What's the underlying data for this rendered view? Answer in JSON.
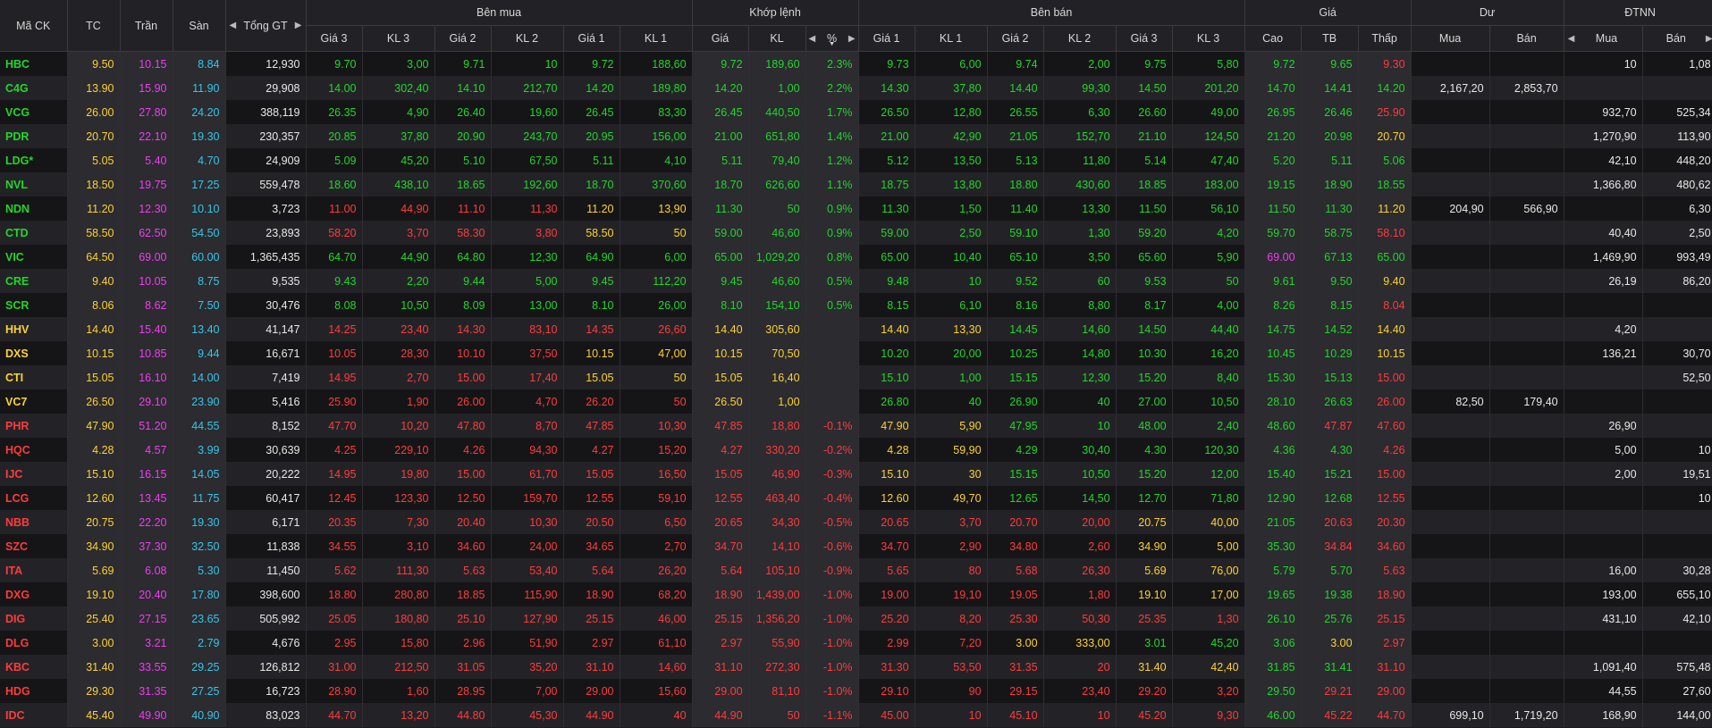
{
  "headers": {
    "symbol": "Mã CK",
    "ref": "TC",
    "ceil": "Trần",
    "floor": "Sàn",
    "total": "Tổng GT",
    "buy_group": "Bên mua",
    "match_group": "Khớp lệnh",
    "sell_group": "Bên bán",
    "price_group": "Giá",
    "rem_group": "Dư",
    "foreign_group": "ĐTNN",
    "buy_cols": [
      "Giá 3",
      "KL 3",
      "Giá 2",
      "KL 2",
      "Giá 1",
      "KL 1"
    ],
    "match_cols": [
      "Giá",
      "KL",
      "%"
    ],
    "sell_cols": [
      "Giá 1",
      "KL 1",
      "Giá 2",
      "KL 2",
      "Giá 3",
      "KL 3"
    ],
    "price_cols": [
      "Cao",
      "TB",
      "Thấp"
    ],
    "rem_cols": [
      "Mua",
      "Bán"
    ],
    "foreign_cols": [
      "Mua",
      "Bán"
    ]
  },
  "icons": {
    "left": "triangle-left-icon",
    "right": "triangle-right-icon",
    "sort": "sort-down-icon"
  },
  "colors": {
    "up": "#22d62a",
    "down": "#ff3b3b",
    "ref": "#ffd230",
    "ceil": "#f23cf0",
    "floor": "#35c6e8"
  },
  "rows": [
    [
      "HBC",
      "9.50",
      "10.15",
      "8.84",
      "12,930",
      "9.70",
      "3,00",
      "9.71",
      "10",
      "9.72",
      "188,60",
      "9.72",
      "189,60",
      "2.3%",
      "9.73",
      "6,00",
      "9.74",
      "2,00",
      "9.75",
      "5,80",
      "9.72",
      "9.65",
      "9.30",
      "",
      "",
      "10",
      "1,08"
    ],
    [
      "C4G",
      "13.90",
      "15.90",
      "11.90",
      "29,908",
      "14.00",
      "302,40",
      "14.10",
      "212,70",
      "14.20",
      "189,80",
      "14.20",
      "1,00",
      "2.2%",
      "14.30",
      "37,80",
      "14.40",
      "99,30",
      "14.50",
      "201,20",
      "14.70",
      "14.41",
      "14.20",
      "2,167,20",
      "2,853,70",
      "",
      ""
    ],
    [
      "VCG",
      "26.00",
      "27.80",
      "24.20",
      "388,119",
      "26.35",
      "4,90",
      "26.40",
      "19,60",
      "26.45",
      "83,30",
      "26.45",
      "440,50",
      "1.7%",
      "26.50",
      "12,80",
      "26.55",
      "6,30",
      "26.60",
      "49,00",
      "26.95",
      "26.46",
      "25.90",
      "",
      "",
      "932,70",
      "525,34"
    ],
    [
      "PDR",
      "20.70",
      "22.10",
      "19.30",
      "230,357",
      "20.85",
      "37,80",
      "20.90",
      "243,70",
      "20.95",
      "156,00",
      "21.00",
      "651,80",
      "1.4%",
      "21.00",
      "42,90",
      "21.05",
      "152,70",
      "21.10",
      "124,50",
      "21.20",
      "20.98",
      "20.70",
      "",
      "",
      "1,270,90",
      "113,90"
    ],
    [
      "LDG*",
      "5.05",
      "5.40",
      "4.70",
      "24,909",
      "5.09",
      "45,20",
      "5.10",
      "67,50",
      "5.11",
      "4,10",
      "5.11",
      "79,40",
      "1.2%",
      "5.12",
      "13,50",
      "5.13",
      "11,80",
      "5.14",
      "47,40",
      "5.20",
      "5.11",
      "5.06",
      "",
      "",
      "42,10",
      "448,20"
    ],
    [
      "NVL",
      "18.50",
      "19.75",
      "17.25",
      "559,478",
      "18.60",
      "438,10",
      "18.65",
      "192,60",
      "18.70",
      "370,60",
      "18.70",
      "626,60",
      "1.1%",
      "18.75",
      "13,80",
      "18.80",
      "430,60",
      "18.85",
      "183,00",
      "19.15",
      "18.90",
      "18.55",
      "",
      "",
      "1,366,80",
      "480,62"
    ],
    [
      "NDN",
      "11.20",
      "12.30",
      "10.10",
      "3,723",
      "11.00",
      "44,90",
      "11.10",
      "11,30",
      "11.20",
      "13,90",
      "11.30",
      "50",
      "0.9%",
      "11.30",
      "1,50",
      "11.40",
      "13,30",
      "11.50",
      "56,10",
      "11.50",
      "11.30",
      "11.20",
      "204,90",
      "566,90",
      "",
      "6,30"
    ],
    [
      "CTD",
      "58.50",
      "62.50",
      "54.50",
      "23,893",
      "58.20",
      "3,70",
      "58.30",
      "3,80",
      "58.50",
      "50",
      "59.00",
      "46,60",
      "0.9%",
      "59.00",
      "2,50",
      "59.10",
      "1,30",
      "59.20",
      "4,20",
      "59.70",
      "58.75",
      "58.10",
      "",
      "",
      "40,40",
      "2,50"
    ],
    [
      "VIC",
      "64.50",
      "69.00",
      "60.00",
      "1,365,435",
      "64.70",
      "44,90",
      "64.80",
      "12,30",
      "64.90",
      "6,00",
      "65.00",
      "1,029,20",
      "0.8%",
      "65.00",
      "10,40",
      "65.10",
      "3,50",
      "65.60",
      "5,90",
      "69.00",
      "67.13",
      "65.00",
      "",
      "",
      "1,469,90",
      "993,49"
    ],
    [
      "CRE",
      "9.40",
      "10.05",
      "8.75",
      "9,535",
      "9.43",
      "2,20",
      "9.44",
      "5,00",
      "9.45",
      "112,20",
      "9.45",
      "46,60",
      "0.5%",
      "9.48",
      "10",
      "9.52",
      "60",
      "9.53",
      "50",
      "9.61",
      "9.50",
      "9.40",
      "",
      "",
      "26,19",
      "86,20"
    ],
    [
      "SCR",
      "8.06",
      "8.62",
      "7.50",
      "30,476",
      "8.08",
      "10,50",
      "8.09",
      "13,00",
      "8.10",
      "26,00",
      "8.10",
      "154,10",
      "0.5%",
      "8.15",
      "6,10",
      "8.16",
      "8,80",
      "8.17",
      "4,00",
      "8.26",
      "8.15",
      "8.04",
      "",
      "",
      "",
      ""
    ],
    [
      "HHV",
      "14.40",
      "15.40",
      "13.40",
      "41,147",
      "14.25",
      "23,40",
      "14.30",
      "83,10",
      "14.35",
      "26,60",
      "14.40",
      "305,60",
      "",
      "14.40",
      "13,30",
      "14.45",
      "14,60",
      "14.50",
      "44,40",
      "14.75",
      "14.52",
      "14.40",
      "",
      "",
      "4,20",
      ""
    ],
    [
      "DXS",
      "10.15",
      "10.85",
      "9.44",
      "16,671",
      "10.05",
      "28,30",
      "10.10",
      "37,50",
      "10.15",
      "47,00",
      "10.15",
      "70,50",
      "",
      "10.20",
      "20,00",
      "10.25",
      "14,80",
      "10.30",
      "16,20",
      "10.45",
      "10.29",
      "10.15",
      "",
      "",
      "136,21",
      "30,70"
    ],
    [
      "CTI",
      "15.05",
      "16.10",
      "14.00",
      "7,419",
      "14.95",
      "2,70",
      "15.00",
      "17,40",
      "15.05",
      "50",
      "15.05",
      "16,40",
      "",
      "15.10",
      "1,00",
      "15.15",
      "12,30",
      "15.20",
      "8,40",
      "15.30",
      "15.13",
      "15.00",
      "",
      "",
      "",
      "52,50"
    ],
    [
      "VC7",
      "26.50",
      "29.10",
      "23.90",
      "5,416",
      "25.90",
      "1,90",
      "26.00",
      "4,70",
      "26.20",
      "50",
      "26.50",
      "1,00",
      "",
      "26.80",
      "40",
      "26.90",
      "40",
      "27.00",
      "10,50",
      "28.10",
      "26.63",
      "26.00",
      "82,50",
      "179,40",
      "",
      ""
    ],
    [
      "PHR",
      "47.90",
      "51.20",
      "44.55",
      "8,152",
      "47.70",
      "10,20",
      "47.80",
      "8,70",
      "47.85",
      "10,30",
      "47.85",
      "18,80",
      "-0.1%",
      "47.90",
      "5,90",
      "47.95",
      "10",
      "48.00",
      "2,40",
      "48.60",
      "47.87",
      "47.60",
      "",
      "",
      "26,90",
      ""
    ],
    [
      "HQC",
      "4.28",
      "4.57",
      "3.99",
      "30,639",
      "4.25",
      "229,10",
      "4.26",
      "94,30",
      "4.27",
      "15,20",
      "4.27",
      "330,20",
      "-0.2%",
      "4.28",
      "59,90",
      "4.29",
      "30,40",
      "4.30",
      "120,30",
      "4.36",
      "4.30",
      "4.26",
      "",
      "",
      "5,00",
      "10"
    ],
    [
      "IJC",
      "15.10",
      "16.15",
      "14.05",
      "20,222",
      "14.95",
      "19,80",
      "15.00",
      "61,70",
      "15.05",
      "16,50",
      "15.05",
      "46,90",
      "-0.3%",
      "15.10",
      "30",
      "15.15",
      "10,50",
      "15.20",
      "12,00",
      "15.40",
      "15.21",
      "15.00",
      "",
      "",
      "2,00",
      "19,51"
    ],
    [
      "LCG",
      "12.60",
      "13.45",
      "11.75",
      "60,417",
      "12.45",
      "123,30",
      "12.50",
      "159,70",
      "12.55",
      "59,10",
      "12.55",
      "463,40",
      "-0.4%",
      "12.60",
      "49,70",
      "12.65",
      "14,50",
      "12.70",
      "71,80",
      "12.90",
      "12.68",
      "12.55",
      "",
      "",
      "",
      "10"
    ],
    [
      "NBB",
      "20.75",
      "22.20",
      "19.30",
      "6,171",
      "20.35",
      "7,30",
      "20.40",
      "10,30",
      "20.50",
      "6,50",
      "20.65",
      "34,30",
      "-0.5%",
      "20.65",
      "3,70",
      "20.70",
      "20,00",
      "20.75",
      "40,00",
      "21.05",
      "20.63",
      "20.30",
      "",
      "",
      "",
      ""
    ],
    [
      "SZC",
      "34.90",
      "37.30",
      "32.50",
      "11,838",
      "34.55",
      "3,10",
      "34.60",
      "24,00",
      "34.65",
      "2,70",
      "34.70",
      "14,10",
      "-0.6%",
      "34.70",
      "2,90",
      "34.80",
      "2,60",
      "34.90",
      "5,00",
      "35.30",
      "34.84",
      "34.60",
      "",
      "",
      "",
      ""
    ],
    [
      "ITA",
      "5.69",
      "6.08",
      "5.30",
      "11,450",
      "5.62",
      "111,30",
      "5.63",
      "53,40",
      "5.64",
      "26,20",
      "5.64",
      "105,10",
      "-0.9%",
      "5.65",
      "80",
      "5.68",
      "26,30",
      "5.69",
      "76,00",
      "5.79",
      "5.70",
      "5.63",
      "",
      "",
      "16,00",
      "30,28"
    ],
    [
      "DXG",
      "19.10",
      "20.40",
      "17.80",
      "398,600",
      "18.80",
      "280,80",
      "18.85",
      "115,90",
      "18.90",
      "68,20",
      "18.90",
      "1,439,00",
      "-1.0%",
      "19.00",
      "19,10",
      "19.05",
      "1,80",
      "19.10",
      "17,00",
      "19.65",
      "19.38",
      "18.90",
      "",
      "",
      "193,00",
      "655,10"
    ],
    [
      "DIG",
      "25.40",
      "27.15",
      "23.65",
      "505,992",
      "25.05",
      "180,80",
      "25.10",
      "127,90",
      "25.15",
      "46,00",
      "25.15",
      "1,356,20",
      "-1.0%",
      "25.20",
      "8,20",
      "25.30",
      "50,30",
      "25.35",
      "1,30",
      "26.10",
      "25.76",
      "25.15",
      "",
      "",
      "431,10",
      "42,10"
    ],
    [
      "DLG",
      "3.00",
      "3.21",
      "2.79",
      "4,676",
      "2.95",
      "15,80",
      "2.96",
      "51,90",
      "2.97",
      "61,10",
      "2.97",
      "55,90",
      "-1.0%",
      "2.99",
      "7,20",
      "3.00",
      "333,00",
      "3.01",
      "45,20",
      "3.06",
      "3.00",
      "2.97",
      "",
      "",
      "",
      ""
    ],
    [
      "KBC",
      "31.40",
      "33.55",
      "29.25",
      "126,812",
      "31.00",
      "212,50",
      "31.05",
      "35,20",
      "31.10",
      "14,60",
      "31.10",
      "272,30",
      "-1.0%",
      "31.30",
      "53,50",
      "31.35",
      "20",
      "31.40",
      "42,40",
      "31.85",
      "31.41",
      "31.10",
      "",
      "",
      "1,091,40",
      "575,48"
    ],
    [
      "HDG",
      "29.30",
      "31.35",
      "27.25",
      "16,723",
      "28.90",
      "1,60",
      "28.95",
      "7,00",
      "29.00",
      "15,60",
      "29.00",
      "81,10",
      "-1.0%",
      "29.10",
      "90",
      "29.15",
      "23,40",
      "29.20",
      "3,20",
      "29.50",
      "29.21",
      "29.00",
      "",
      "",
      "44,55",
      "27,60"
    ],
    [
      "IDC",
      "45.40",
      "49.90",
      "40.90",
      "83,023",
      "44.70",
      "13,20",
      "44.80",
      "45,30",
      "44.90",
      "40",
      "44.90",
      "50",
      "-1.1%",
      "45.00",
      "10",
      "45.10",
      "10",
      "45.20",
      "9,30",
      "46.00",
      "45.22",
      "44.70",
      "699,10",
      "1,719,20",
      "168,90",
      "144,00"
    ]
  ]
}
